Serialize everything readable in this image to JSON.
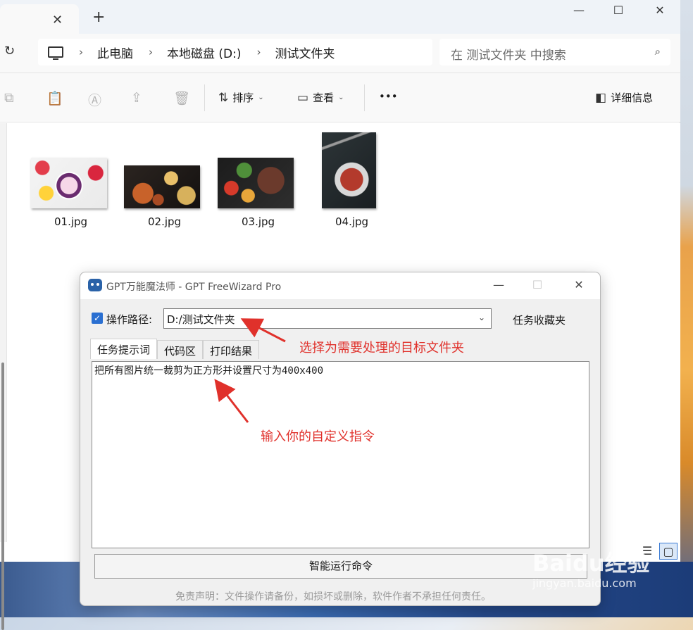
{
  "explorer": {
    "tab_close": "✕",
    "tab_new": "+",
    "window_controls": [
      "—",
      "☐",
      "✕"
    ],
    "refresh_icon": "refresh-icon",
    "breadcrumb": [
      "此电脑",
      "本地磁盘 (D:)",
      "测试文件夹"
    ],
    "breadcrumb_sep": "›",
    "search_placeholder": "在 测试文件夹 中搜索",
    "toolbar": {
      "sort_label": "排序",
      "view_label": "查看",
      "more_label": "•••",
      "details_label": "详细信息"
    },
    "files": [
      {
        "name": "01.jpg"
      },
      {
        "name": "02.jpg"
      },
      {
        "name": "03.jpg"
      },
      {
        "name": "04.jpg"
      }
    ]
  },
  "dialog": {
    "title": "GPT万能魔法师 - GPT FreeWizard Pro",
    "path_label": "操作路径:",
    "path_value": "D:/测试文件夹",
    "favorites_label": "任务收藏夹",
    "tabs": [
      "任务提示词",
      "代码区",
      "打印结果"
    ],
    "prompt_text": "把所有图片统一裁剪为正方形并设置尺寸为400x400",
    "run_label": "智能运行命令",
    "disclaimer": "免责声明：文件操作请备份，如损坏或删除，软件作者不承担任何责任。"
  },
  "annotations": {
    "select_folder": "选择为需要处理的目标文件夹",
    "custom_command": "输入你的自定义指令"
  },
  "watermark": {
    "main": "Baidu经验",
    "sub": "jingyan.baidu.com"
  },
  "colors": {
    "accent": "#2a6fd1",
    "annotation": "#e0312b"
  }
}
